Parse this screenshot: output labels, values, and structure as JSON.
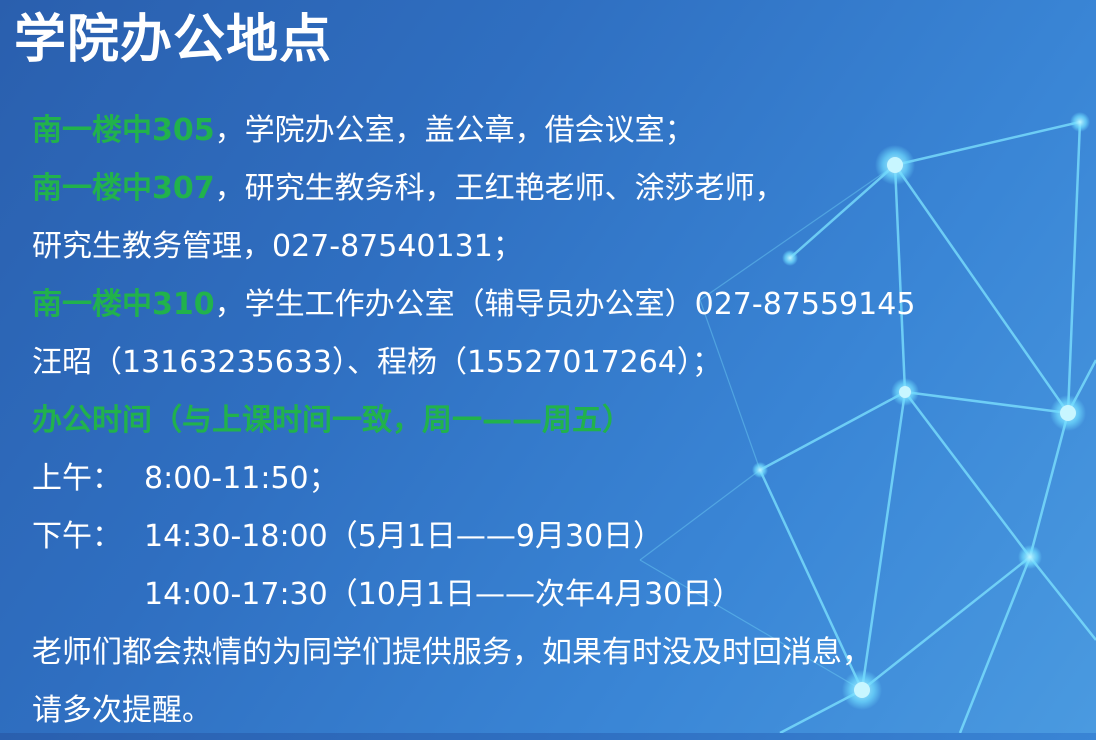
{
  "title": "学院办公地点",
  "lines": {
    "l1": {
      "highlight": "南一楼中305",
      "text": "，学院办公室，盖公章，借会议室；"
    },
    "l2": {
      "highlight": "南一楼中307",
      "text": "，研究生教务科，王红艳老师、涂莎老师，"
    },
    "l3": {
      "text": "研究生教务管理，027-87540131；"
    },
    "l4": {
      "highlight": "南一楼中310",
      "text": "，学生工作办公室（辅导员办公室）027-87559145"
    },
    "l5": {
      "text": "汪昭（13163235633）、程杨（15527017264）；"
    },
    "l6": {
      "highlight": "办公时间（与上课时间一致，周一——周五）"
    },
    "l7": {
      "label": "上午：",
      "text": "8:00-11:50；"
    },
    "l8": {
      "label": "下午：",
      "text": "14:30-18:00（5月1日——9月30日）"
    },
    "l9": {
      "text": "14:00-17:30（10月1日——次年4月30日）"
    },
    "l10": {
      "text": "老师们都会热情的为同学们提供服务，如果有时没及时回消息，"
    },
    "l11": {
      "text": "请多次提醒。"
    }
  },
  "colors": {
    "highlight": "#21b24c",
    "text": "#ffffff",
    "background": "#2f6fc1",
    "network": "#7fe4ff"
  }
}
